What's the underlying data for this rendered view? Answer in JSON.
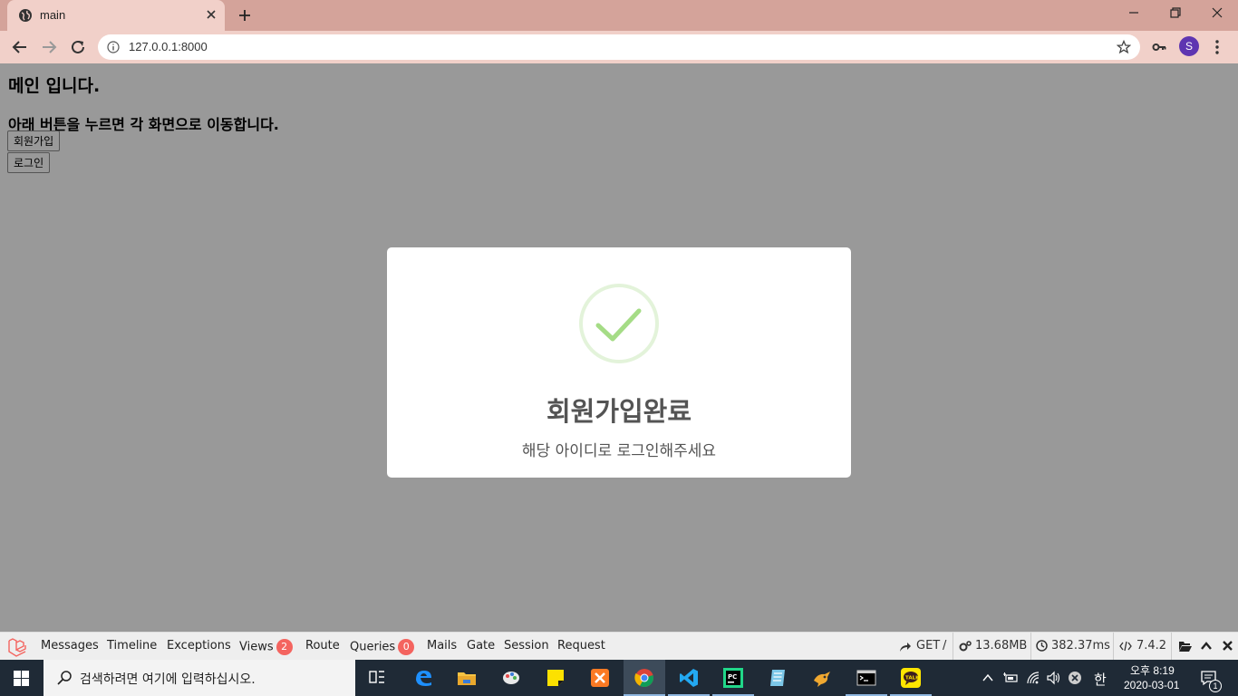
{
  "browser": {
    "tab_title": "main",
    "url": "127.0.0.1:8000",
    "profile_initial": "S"
  },
  "page": {
    "heading": "메인 입니다.",
    "instruction": "아래 버튼을 누르면 각 화면으로 이동합니다.",
    "signup_button": "회원가입",
    "login_button": "로그인"
  },
  "modal": {
    "title": "회원가입완료",
    "text": "해당 아이디로 로그인해주세요",
    "icon": "success-check-icon",
    "accent_color": "#a5dc86"
  },
  "debugbar": {
    "tabs": [
      {
        "label": "Messages"
      },
      {
        "label": "Timeline"
      },
      {
        "label": "Exceptions"
      },
      {
        "label": "Views",
        "badge": "2"
      },
      {
        "label": "Route"
      },
      {
        "label": "Queries",
        "badge": "0"
      },
      {
        "label": "Mails"
      },
      {
        "label": "Gate"
      },
      {
        "label": "Session"
      },
      {
        "label": "Request"
      }
    ],
    "method": "GET",
    "path": "/",
    "memory": "13.68MB",
    "time": "382.37ms",
    "php_version": "7.4.2"
  },
  "taskbar": {
    "search_placeholder": "검색하려면 여기에 입력하십시오.",
    "ime": "한",
    "time": "오후 8:19",
    "date": "2020-03-01",
    "notification_count": "1"
  }
}
